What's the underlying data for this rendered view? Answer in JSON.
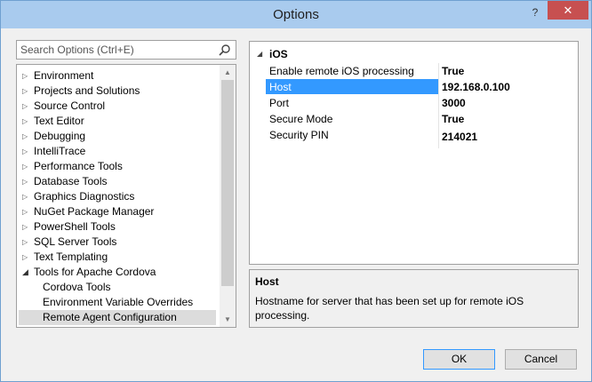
{
  "window": {
    "title": "Options",
    "help_label": "?",
    "close_label": "✕"
  },
  "search": {
    "placeholder": "Search Options (Ctrl+E)",
    "value": ""
  },
  "tree": {
    "items": [
      {
        "label": "Environment",
        "expanded": false,
        "level": 0
      },
      {
        "label": "Projects and Solutions",
        "expanded": false,
        "level": 0
      },
      {
        "label": "Source Control",
        "expanded": false,
        "level": 0
      },
      {
        "label": "Text Editor",
        "expanded": false,
        "level": 0
      },
      {
        "label": "Debugging",
        "expanded": false,
        "level": 0
      },
      {
        "label": "IntelliTrace",
        "expanded": false,
        "level": 0
      },
      {
        "label": "Performance Tools",
        "expanded": false,
        "level": 0
      },
      {
        "label": "Database Tools",
        "expanded": false,
        "level": 0
      },
      {
        "label": "Graphics Diagnostics",
        "expanded": false,
        "level": 0
      },
      {
        "label": "NuGet Package Manager",
        "expanded": false,
        "level": 0
      },
      {
        "label": "PowerShell Tools",
        "expanded": false,
        "level": 0
      },
      {
        "label": "SQL Server Tools",
        "expanded": false,
        "level": 0
      },
      {
        "label": "Text Templating",
        "expanded": false,
        "level": 0
      },
      {
        "label": "Tools for Apache Cordova",
        "expanded": true,
        "level": 0
      },
      {
        "label": "Cordova Tools",
        "level": 1
      },
      {
        "label": "Environment Variable Overrides",
        "level": 1
      },
      {
        "label": "Remote Agent Configuration",
        "level": 1,
        "selected": true
      }
    ]
  },
  "properties": {
    "category": "iOS",
    "rows": [
      {
        "name": "Enable remote iOS processing",
        "value": "True"
      },
      {
        "name": "Host",
        "value": "192.168.0.100",
        "selected": true
      },
      {
        "name": "Port",
        "value": "3000"
      },
      {
        "name": "Secure Mode",
        "value": "True"
      },
      {
        "name": "Security PIN",
        "value": "214021"
      }
    ]
  },
  "description": {
    "title": "Host",
    "text": "Hostname for server that has been set up for remote iOS processing."
  },
  "buttons": {
    "ok": "OK",
    "cancel": "Cancel"
  },
  "colors": {
    "titlebar": "#a9cbee",
    "close": "#c75050",
    "selection": "#3399ff"
  }
}
